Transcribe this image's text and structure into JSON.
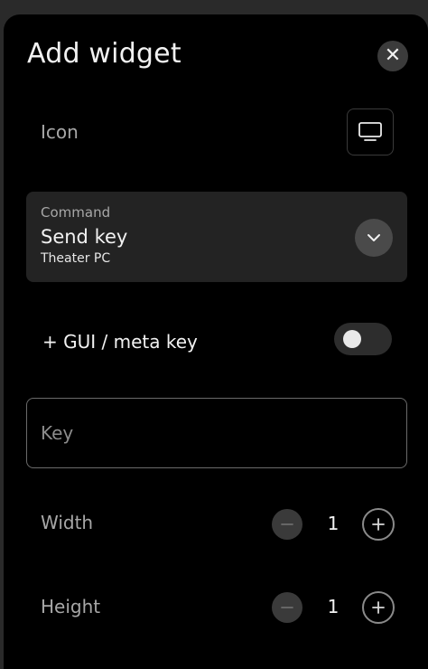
{
  "dialog": {
    "title": "Add widget",
    "close_icon": "close-icon"
  },
  "icon_row": {
    "label": "Icon",
    "icon": "tv-monitor-icon"
  },
  "command": {
    "caption": "Command",
    "value": "Send key",
    "device": "Theater PC",
    "dropdown_icon": "chevron-down-icon"
  },
  "meta_toggle": {
    "label": "+ GUI / meta key",
    "enabled": false
  },
  "key_field": {
    "placeholder": "Key",
    "value": ""
  },
  "width": {
    "label": "Width",
    "value": "1"
  },
  "height": {
    "label": "Height",
    "value": "1"
  },
  "colors": {
    "background": "#000000",
    "card": "#232323",
    "text": "#f2f2f2",
    "muted_text": "#a7a7a7"
  }
}
